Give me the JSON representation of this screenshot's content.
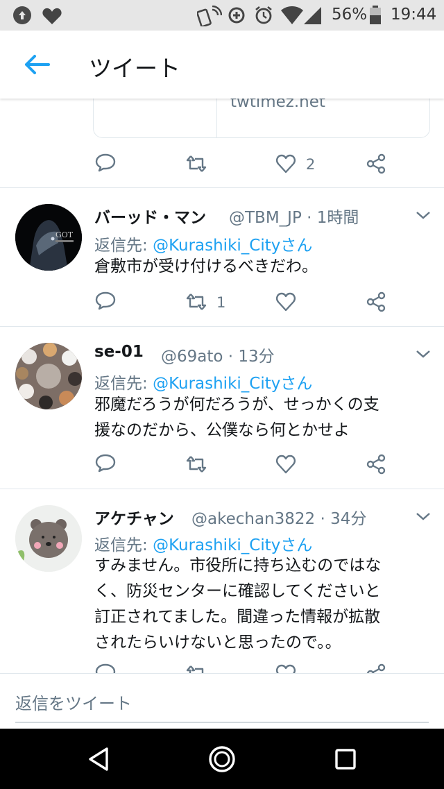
{
  "status_bar": {
    "battery": "56%",
    "time": "19:44"
  },
  "header": {
    "title": "ツイート"
  },
  "link_card": {
    "domain": "twtimez.net"
  },
  "top_actions": {
    "like_count": "2"
  },
  "reply_label": "返信先:",
  "tweets": [
    {
      "name": "バーッド・マン",
      "handle_time": "@TBM_JP · 1時間",
      "reply_to": "@Kurashiki_Cityさん",
      "lines": [
        "倉敷市が受け付けるべきだわ。"
      ],
      "avatar_text": "GOT",
      "retweet_count": "1",
      "like_count": ""
    },
    {
      "name": "se-01",
      "handle_time": "@69ato · 13分",
      "reply_to": "@Kurashiki_Cityさん",
      "lines": [
        "邪魔だろうが何だろうが、せっかくの支",
        "援なのだから、公僕なら何とかせよ"
      ],
      "retweet_count": "",
      "like_count": ""
    },
    {
      "name": "アケチャン",
      "handle_time": "@akechan3822 · 34分",
      "reply_to": "@Kurashiki_Cityさん",
      "lines": [
        "すみません。市役所に持ち込むのではな",
        "く、防災センターに確認してくださいと",
        "訂正されてました。間違った情報が拡散",
        "されたらいけないと思ったので。。"
      ],
      "retweet_count": "",
      "like_count": ""
    }
  ],
  "compose": {
    "placeholder": "返信をツイート"
  },
  "colors": {
    "accent": "#1da1f2",
    "secondary_text": "#657786",
    "border": "#e1e8ed"
  }
}
